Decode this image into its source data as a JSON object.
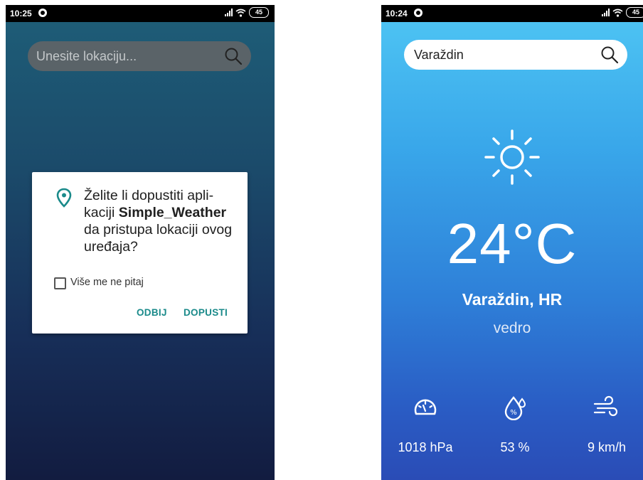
{
  "left_screen": {
    "status": {
      "time": "10:25",
      "battery": "45"
    },
    "search": {
      "placeholder": "Unesite lokaciju..."
    },
    "dialog": {
      "message_before": "Želite li dopustiti apli-kaciji ",
      "app_name": "Simple_Weather",
      "message_after": " da pristupa lokaciji ovog uređaja?",
      "checkbox_label": "Više me ne pitaj",
      "checkbox_checked": false,
      "deny_label": "ODBIJ",
      "allow_label": "DOPUSTI"
    },
    "colors": {
      "accent": "#1a8a8a"
    }
  },
  "right_screen": {
    "status": {
      "time": "10:24",
      "battery": "45"
    },
    "search": {
      "value": "Varaždin"
    },
    "weather": {
      "icon": "sun-icon",
      "temperature": "24°C",
      "location": "Varaždin, HR",
      "condition": "vedro"
    },
    "metrics": {
      "pressure": {
        "icon": "pressure-gauge-icon",
        "value": "1018 hPa"
      },
      "humidity": {
        "icon": "humidity-drop-icon",
        "value": "53 %"
      },
      "wind": {
        "icon": "wind-icon",
        "value": "9 km/h"
      }
    }
  }
}
